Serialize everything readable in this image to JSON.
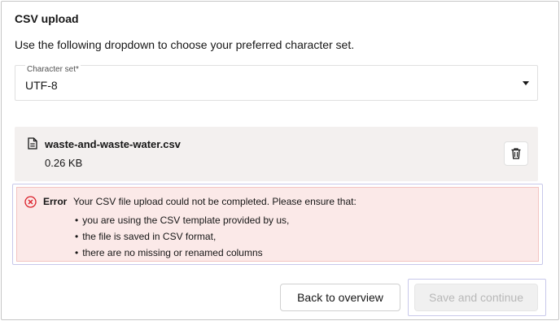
{
  "section": {
    "title": "CSV upload",
    "description": "Use the following dropdown to choose your preferred character set."
  },
  "character_set": {
    "label": "Character set*",
    "value": "UTF-8",
    "caret_icon": "caret-down-icon"
  },
  "file": {
    "icon": "document-icon",
    "name": "waste-and-waste-water.csv",
    "size": "0.26 KB",
    "delete_icon": "trash-icon"
  },
  "error": {
    "icon": "error-circle-icon",
    "title": "Error",
    "message": "Your CSV file upload could not be completed. Please ensure that:",
    "items": [
      "you are using the CSV template provided by us,",
      "the file is saved in CSV format,",
      "there are no missing or renamed columns"
    ],
    "color": "#da1e28"
  },
  "actions": {
    "back_label": "Back to overview",
    "save_label": "Save and continue"
  }
}
